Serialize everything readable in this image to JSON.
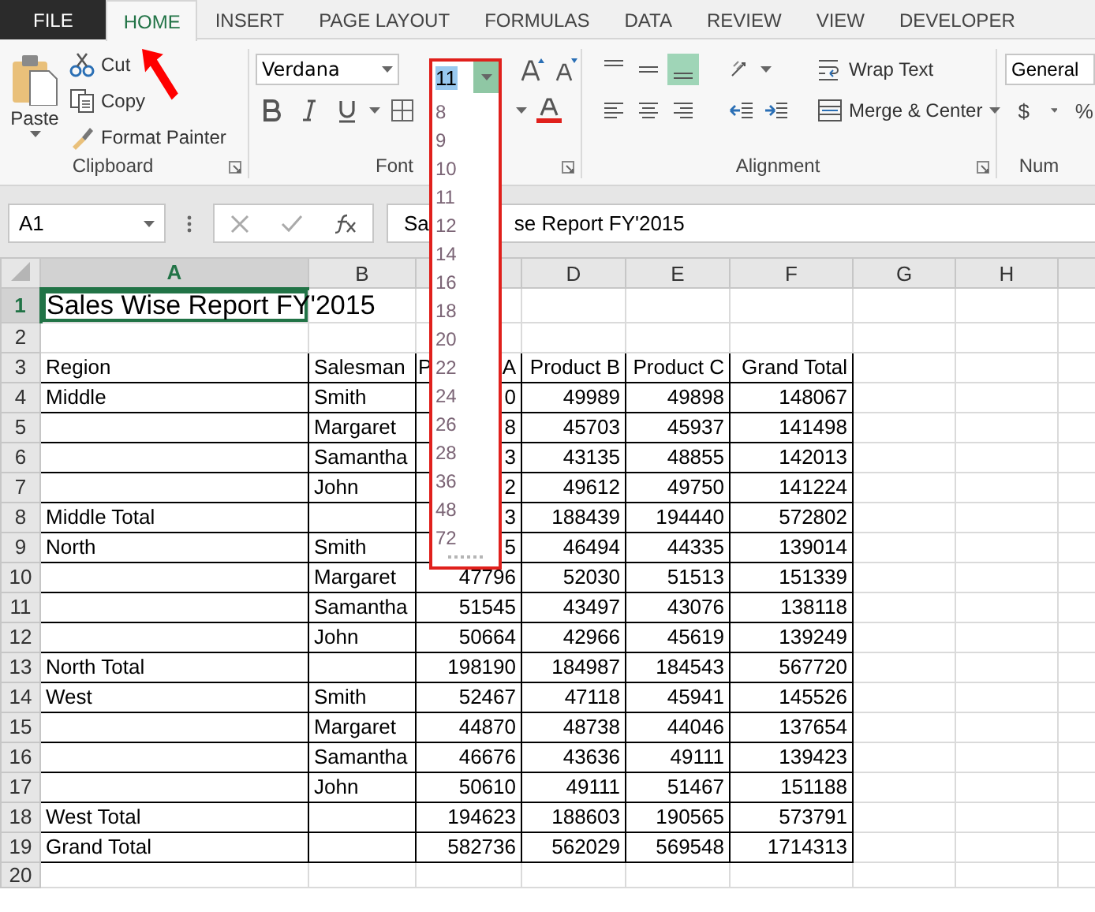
{
  "ribbon_tabs": [
    {
      "label": "FILE",
      "kind": "file",
      "selected": false
    },
    {
      "label": "HOME",
      "kind": "tab",
      "selected": true
    },
    {
      "label": "INSERT",
      "kind": "tab",
      "selected": false
    },
    {
      "label": "PAGE LAYOUT",
      "kind": "tab",
      "selected": false
    },
    {
      "label": "FORMULAS",
      "kind": "tab",
      "selected": false
    },
    {
      "label": "DATA",
      "kind": "tab",
      "selected": false
    },
    {
      "label": "REVIEW",
      "kind": "tab",
      "selected": false
    },
    {
      "label": "VIEW",
      "kind": "tab",
      "selected": false
    },
    {
      "label": "DEVELOPER",
      "kind": "tab",
      "selected": false
    }
  ],
  "clipboard": {
    "paste": "Paste",
    "cut": "Cut",
    "copy": "Copy",
    "format_painter": "Format Painter",
    "label": "Clipboard"
  },
  "font": {
    "name": "Verdana",
    "size": "11",
    "label": "Font"
  },
  "font_size_list": [
    "8",
    "9",
    "10",
    "11",
    "12",
    "14",
    "16",
    "18",
    "20",
    "22",
    "24",
    "26",
    "28",
    "36",
    "48",
    "72"
  ],
  "alignment": {
    "vertical": [
      {
        "kind": "top",
        "on": false
      },
      {
        "kind": "middle",
        "on": false
      },
      {
        "kind": "bottom",
        "on": true
      }
    ],
    "wrap_text": "Wrap Text",
    "merge": "Merge & Center",
    "label": "Alignment"
  },
  "number": {
    "format": "General",
    "currency": "$",
    "percent": "%",
    "label": "Num"
  },
  "formula_bar": {
    "name_box": "A1",
    "formula_parts": [
      "Sa",
      "se Report FY'2015"
    ]
  },
  "columns": [
    {
      "label": "A",
      "selected": true
    },
    {
      "label": "B",
      "selected": false
    },
    {
      "selected": false
    },
    {
      "label": "D",
      "selected": false
    },
    {
      "label": "E",
      "selected": false
    },
    {
      "label": "F",
      "selected": false
    },
    {
      "label": "G",
      "selected": false
    },
    {
      "label": "H",
      "selected": false
    }
  ],
  "rows": [
    {
      "number": "1",
      "selected": true,
      "bordered": false,
      "cells": {
        "A": "Sales Wise Report FY'2015"
      }
    },
    {
      "number": "2",
      "selected": false,
      "bordered": false,
      "cells": {}
    },
    {
      "number": "3",
      "selected": false,
      "bordered": true,
      "cells": {
        "A": "Region",
        "B": "Salesman",
        "C": [
          "P",
          "A"
        ],
        "D": "Product B",
        "E": "Product C",
        "F": "Grand Total"
      }
    },
    {
      "number": "4",
      "selected": false,
      "bordered": true,
      "cells": {
        "A": "Middle",
        "B": "Smith",
        "C": "0",
        "D": "49989",
        "E": "49898",
        "F": "148067"
      }
    },
    {
      "number": "5",
      "selected": false,
      "bordered": true,
      "cells": {
        "B": "Margaret",
        "C": "8",
        "D": "45703",
        "E": "45937",
        "F": "141498"
      }
    },
    {
      "number": "6",
      "selected": false,
      "bordered": true,
      "cells": {
        "B": "Samantha",
        "C": "3",
        "D": "43135",
        "E": "48855",
        "F": "142013"
      }
    },
    {
      "number": "7",
      "selected": false,
      "bordered": true,
      "cells": {
        "B": "John",
        "C": "2",
        "D": "49612",
        "E": "49750",
        "F": "141224"
      }
    },
    {
      "number": "8",
      "selected": false,
      "bordered": true,
      "cells": {
        "A": "Middle Total",
        "C": "3",
        "D": "188439",
        "E": "194440",
        "F": "572802"
      }
    },
    {
      "number": "9",
      "selected": false,
      "bordered": true,
      "cells": {
        "A": "North",
        "B": "Smith",
        "C": "5",
        "D": "46494",
        "E": "44335",
        "F": "139014"
      }
    },
    {
      "number": "10",
      "selected": false,
      "bordered": true,
      "cells": {
        "B": "Margaret",
        "C": "47796",
        "D": "52030",
        "E": "51513",
        "F": "151339"
      }
    },
    {
      "number": "11",
      "selected": false,
      "bordered": true,
      "cells": {
        "B": "Samantha",
        "C": "51545",
        "D": "43497",
        "E": "43076",
        "F": "138118"
      }
    },
    {
      "number": "12",
      "selected": false,
      "bordered": true,
      "cells": {
        "B": "John",
        "C": "50664",
        "D": "42966",
        "E": "45619",
        "F": "139249"
      }
    },
    {
      "number": "13",
      "selected": false,
      "bordered": true,
      "cells": {
        "A": "North Total",
        "C": "198190",
        "D": "184987",
        "E": "184543",
        "F": "567720"
      }
    },
    {
      "number": "14",
      "selected": false,
      "bordered": true,
      "cells": {
        "A": "West",
        "B": "Smith",
        "C": "52467",
        "D": "47118",
        "E": "45941",
        "F": "145526"
      }
    },
    {
      "number": "15",
      "selected": false,
      "bordered": true,
      "cells": {
        "B": "Margaret",
        "C": "44870",
        "D": "48738",
        "E": "44046",
        "F": "137654"
      }
    },
    {
      "number": "16",
      "selected": false,
      "bordered": true,
      "cells": {
        "B": "Samantha",
        "C": "46676",
        "D": "43636",
        "E": "49111",
        "F": "139423"
      }
    },
    {
      "number": "17",
      "selected": false,
      "bordered": true,
      "cells": {
        "B": "John",
        "C": "50610",
        "D": "49111",
        "E": "51467",
        "F": "151188"
      }
    },
    {
      "number": "18",
      "selected": false,
      "bordered": true,
      "cells": {
        "A": "West Total",
        "C": "194623",
        "D": "188603",
        "E": "190565",
        "F": "573791"
      }
    },
    {
      "number": "19",
      "selected": false,
      "bordered": true,
      "cells": {
        "A": "Grand Total",
        "C": "582736",
        "D": "562029",
        "E": "569548",
        "F": "1714313"
      }
    },
    {
      "number": "20",
      "selected": false,
      "bordered": false,
      "cells": {}
    }
  ]
}
